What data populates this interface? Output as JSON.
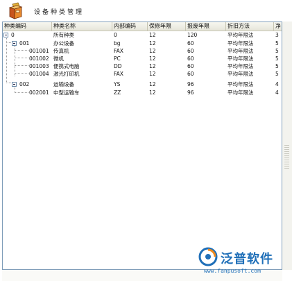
{
  "window": {
    "title": "设备种类管理"
  },
  "grid": {
    "columns": [
      "种类编码",
      "种类名称",
      "内部编码",
      "保修年限",
      "报废年限",
      "折旧方法",
      "净"
    ],
    "rows": [
      {
        "code": "0",
        "name": "所有种类",
        "internal": "0",
        "warranty": "12",
        "scrap": "120",
        "method": "平均年限法",
        "net": "3",
        "level": 0,
        "expandable": true
      },
      {
        "code": "001",
        "name": "办公设备",
        "internal": "bg",
        "warranty": "12",
        "scrap": "60",
        "method": "平均年限法",
        "net": "5",
        "level": 1,
        "expandable": true
      },
      {
        "code": "001001",
        "name": "传真机",
        "internal": "FAX",
        "warranty": "12",
        "scrap": "60",
        "method": "平均年限法",
        "net": "5",
        "level": 2,
        "expandable": false
      },
      {
        "code": "001002",
        "name": "微机",
        "internal": "PC",
        "warranty": "12",
        "scrap": "60",
        "method": "平均年限法",
        "net": "5",
        "level": 2,
        "expandable": false
      },
      {
        "code": "001003",
        "name": "便携式电脑",
        "internal": "DD",
        "warranty": "12",
        "scrap": "60",
        "method": "平均年限法",
        "net": "5",
        "level": 2,
        "expandable": false
      },
      {
        "code": "001004",
        "name": "激光打印机",
        "internal": "FAX",
        "warranty": "12",
        "scrap": "60",
        "method": "平均年限法",
        "net": "5",
        "level": 2,
        "expandable": false
      },
      {
        "code": "002",
        "name": "运输设备",
        "internal": "YS",
        "warranty": "12",
        "scrap": "96",
        "method": "平均年限法",
        "net": "4",
        "level": 1,
        "expandable": true
      },
      {
        "code": "002001",
        "name": "中型运输车",
        "internal": "ZZ",
        "warranty": "12",
        "scrap": "96",
        "method": "平均年限法",
        "net": "4",
        "level": 2,
        "expandable": false
      }
    ]
  },
  "watermark": {
    "brand": "泛普软件",
    "url": "www.fanpusoft.com"
  },
  "colors": {
    "accent": "#1f6fb8",
    "header_bg": "#ecebe0",
    "border": "#7f9db9"
  },
  "icons": {
    "app": "toolbox-icon",
    "logo": "fanpu-logo-icon"
  }
}
